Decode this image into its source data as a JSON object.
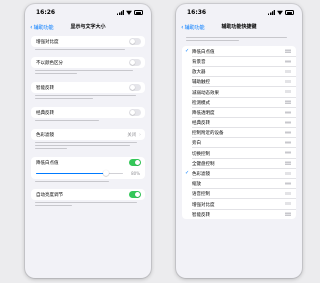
{
  "left": {
    "time": "16:26",
    "back_label": "辅助功能",
    "title": "显示与文字大小",
    "group1": [
      {
        "label": "增强对比度",
        "on": false
      },
      {
        "label": "不以颜色区分",
        "on": false
      },
      {
        "label": "智能反转",
        "on": false
      },
      {
        "label": "经典反转",
        "on": false
      }
    ],
    "color_filter": {
      "label": "色彩滤镜",
      "value": "关闭"
    },
    "white_point": {
      "label": "降低白点值",
      "on": true,
      "level": 0.8,
      "level_text": "80%"
    },
    "auto_brightness": {
      "label": "自动亮度调节",
      "on": true
    }
  },
  "right": {
    "time": "16:36",
    "back_label": "辅助功能",
    "title": "辅助功能快捷键",
    "items": [
      {
        "label": "降低白点值",
        "checked": true
      },
      {
        "label": "背景音",
        "checked": false
      },
      {
        "label": "放大器",
        "checked": false
      },
      {
        "label": "辅助触控",
        "checked": false
      },
      {
        "label": "减弱动态效果",
        "checked": false
      },
      {
        "label": "检测模式",
        "checked": false
      },
      {
        "label": "降低透明度",
        "checked": false
      },
      {
        "label": "经典反转",
        "checked": false
      },
      {
        "label": "控制附近的设备",
        "checked": false
      },
      {
        "label": "旁白",
        "checked": false
      },
      {
        "label": "切换控制",
        "checked": false
      },
      {
        "label": "全键盘控制",
        "checked": false
      },
      {
        "label": "色彩滤镜",
        "checked": true
      },
      {
        "label": "缩放",
        "checked": false
      },
      {
        "label": "语音控制",
        "checked": false
      },
      {
        "label": "增强对比度",
        "checked": false
      },
      {
        "label": "智能反转",
        "checked": false
      }
    ]
  },
  "colors": {
    "accent": "#007aff",
    "toggle_on": "#34c759",
    "toggle_off": "#e5e5ea"
  }
}
